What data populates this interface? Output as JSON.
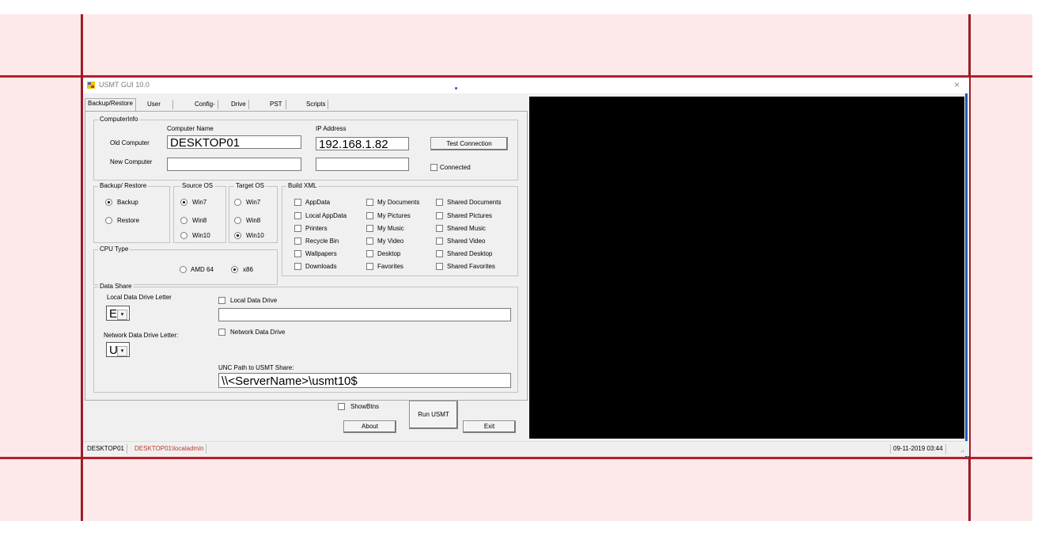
{
  "window": {
    "title": "USMT GUI 10.0",
    "close_glyph": "×"
  },
  "tabs": [
    {
      "label": "Backup/Restore",
      "selected": true
    },
    {
      "label": "User Settings"
    },
    {
      "label": "Config-O"
    },
    {
      "label": "Drive Info"
    },
    {
      "label": "PST Files"
    },
    {
      "label": "Scripts"
    }
  ],
  "computer_info": {
    "group_label": "ComputerInfo",
    "computer_name_header": "Computer Name",
    "ip_header": "IP Address",
    "old_label": "Old Computer",
    "new_label": "New Computer",
    "old_name": "DESKTOP01",
    "old_ip": "192.168.1.82",
    "new_name": "",
    "new_ip": "",
    "test_button": "Test Connection",
    "connected_label": "Connected"
  },
  "backup_restore": {
    "group_label": "Backup/ Restore",
    "backup": "Backup",
    "restore": "Restore"
  },
  "source_os": {
    "group_label": "Source OS",
    "win7": "Win7",
    "win8": "Win8",
    "win10": "Win10"
  },
  "target_os": {
    "group_label": "Target OS",
    "win7": "Win7",
    "win8": "Win8",
    "win10": "Win10"
  },
  "cpu_type": {
    "group_label": "CPU Type",
    "amd64": "AMD 64",
    "x86": "x86"
  },
  "build_xml": {
    "group_label": "Build XML",
    "items": [
      "AppData",
      "My Documents",
      "Shared Documents",
      "Local AppData",
      "My Pictures",
      "Shared Pictures",
      "Printers",
      "My Music",
      "Shared Music",
      "Recycle Bin",
      "My Video",
      "Shared Video",
      "Wallpapers",
      "Desktop",
      "Shared Desktop",
      "Downloads",
      "Favorites",
      "Shared Favorites"
    ]
  },
  "data_share": {
    "group_label": "Data Share",
    "local_letter_label": "Local Data Drive Letter",
    "local_letter_value": "E",
    "local_drive_label": "Local Data Drive",
    "local_drive_value": "",
    "network_letter_label": "Network Data Drive Letter:",
    "network_letter_value": "U",
    "network_drive_label": "Network Data Drive",
    "unc_label": "UNC Path to USMT Share:",
    "unc_value": "\\\\<ServerName>\\usmt10$"
  },
  "bottom": {
    "showbtns": "ShowBtns",
    "run": "Run USMT",
    "about": "About",
    "exit": "Exit"
  },
  "status": {
    "computer": "DESKTOP01",
    "user": "DESKTOP01\\localadmin",
    "datetime": "09-11-2019 03:44"
  },
  "colors": {
    "frame_red": "#b3202c",
    "background_pink": "#fde9e9",
    "console": "#000000",
    "user_text": "#c0392b"
  }
}
